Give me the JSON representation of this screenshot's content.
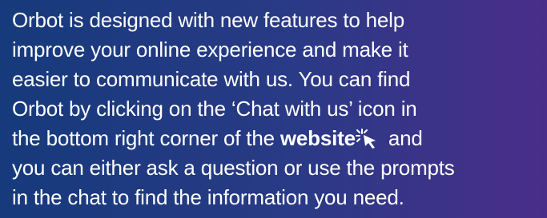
{
  "message": {
    "line1": "Orbot is designed with new features to help",
    "line2": "improve your online experience and make it",
    "line3": "easier to communicate with us. You can find",
    "line4": "Orbot by clicking on the ‘Chat with us’ icon in",
    "line5_prefix": "the bottom right corner of the ",
    "link_text": "website",
    "line5_suffix": " and",
    "line6": "you can either ask a question or use the prompts",
    "line7": "in the chat to find the information you need."
  },
  "icons": {
    "click_icon": "cursor-click-icon"
  },
  "colors": {
    "text": "#ffffff",
    "background_start": "#163a7c",
    "background_end": "#4a2d8a"
  }
}
